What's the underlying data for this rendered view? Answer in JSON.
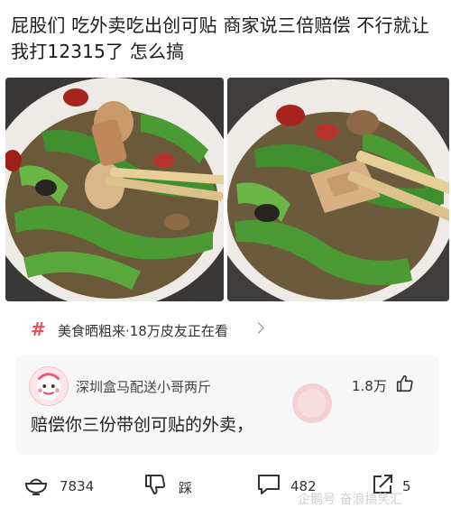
{
  "post": {
    "text": "屁股们 吃外卖吃出创可贴 商家说三倍赔偿 不行就让我打12315了 怎么搞"
  },
  "topic": {
    "icon": "hash-icon",
    "label": "美食晒粗来·18万皮友正在看"
  },
  "comment": {
    "username": "深圳盒马配送小哥两斤",
    "likes": "1.8万",
    "text": "赔偿你三份带创可贴的外卖，"
  },
  "actions": {
    "bowl_count": "7834",
    "dislike_label": "踩",
    "comments_count": "482",
    "shares_count": "5"
  },
  "watermark": {
    "text": "企鹅号 奋浪搞笑汇"
  },
  "colors": {
    "accent": "#e8505b",
    "pepper_green": "#3f8f2e",
    "background": "#ffffff",
    "card": "#f7f7f7"
  }
}
